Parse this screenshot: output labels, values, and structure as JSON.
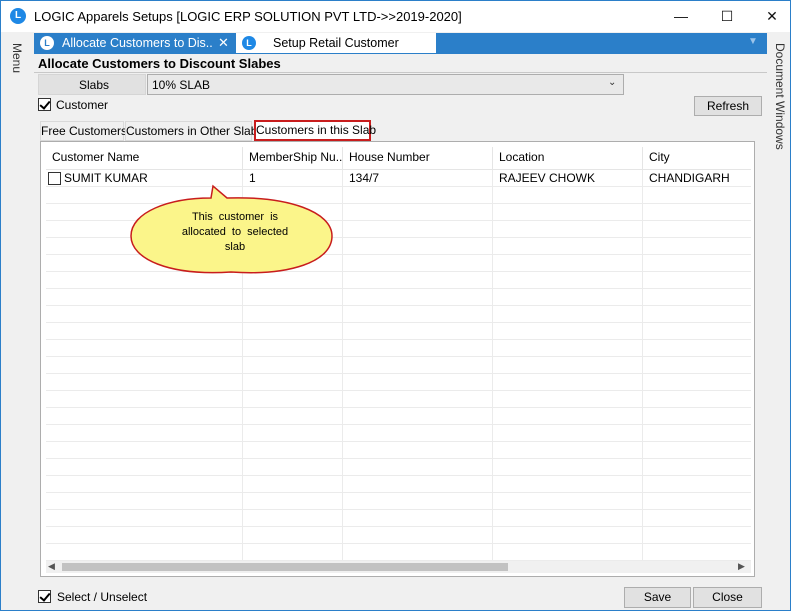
{
  "window": {
    "title": "LOGIC Apparels Setups  [LOGIC ERP SOLUTION PVT LTD->>2019-2020]",
    "minimize_glyph": "—",
    "maximize_glyph": "☐",
    "close_glyph": "✕"
  },
  "side": {
    "menu_label": "Menu",
    "docs_label": "Document Windows"
  },
  "doc_tabs": [
    {
      "label": "Allocate Customers to Dis...",
      "close": "✕",
      "icon": "logic-app-icon"
    },
    {
      "label": "Setup Retail Customer",
      "icon": "logic-app-icon"
    }
  ],
  "form": {
    "heading": "Allocate Customers to Discount Slabes",
    "slabs_label": "Slabs",
    "slab_value": "10% SLAB",
    "customer_label": "Customer",
    "customer_checked": true,
    "refresh_label": "Refresh"
  },
  "subtabs": [
    {
      "label": "Free Customers"
    },
    {
      "label": "Customers in Other Slabs"
    },
    {
      "label": "Customers in this Slab",
      "selected": true
    }
  ],
  "grid": {
    "columns": [
      "Customer Name",
      "MemberShip Nu...",
      "House Number",
      "Location",
      "City"
    ],
    "rows": [
      {
        "checked": false,
        "name": "SUMIT   KUMAR",
        "membership": "1",
        "house": "134/7",
        "location": "RAJEEV CHOWK",
        "city": "CHANDIGARH"
      }
    ]
  },
  "callout": {
    "line1": "This customer is",
    "line2": "allocated to selected",
    "line3": "slab",
    "fill": "#fbf58a",
    "stroke": "#c81d1d"
  },
  "footer": {
    "select_label": "Select / Unselect",
    "select_checked": true,
    "save_label": "Save",
    "close_label": "Close"
  },
  "colors": {
    "accent": "#2b7fc9",
    "highlight_border": "#c81d1d"
  }
}
